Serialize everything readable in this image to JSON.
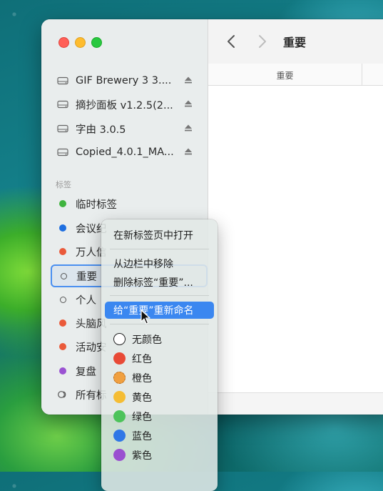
{
  "window": {
    "title": "重要"
  },
  "column": {
    "header": "重要"
  },
  "sidebar": {
    "devices": [
      {
        "label": "GIF Brewery 3 3...."
      },
      {
        "label": "摘抄面板 v1.2.5(2..."
      },
      {
        "label": "字由 3.0.5"
      },
      {
        "label": "Copied_4.0.1_MA..."
      }
    ],
    "tags_heading": "标签",
    "tags": [
      {
        "label": "临时标签",
        "color": "#3fb43f"
      },
      {
        "label": "会议纪",
        "color": "#1f6fe0"
      },
      {
        "label": "万人信",
        "color": "#ea5a3a"
      },
      {
        "label": "重要",
        "color": ""
      },
      {
        "label": "个人",
        "color": ""
      },
      {
        "label": "头脑风",
        "color": "#ea5a3a"
      },
      {
        "label": "活动安",
        "color": "#ea5a3a"
      },
      {
        "label": "复盘",
        "color": "#9a52d2"
      },
      {
        "label": "所有标",
        "color": ""
      }
    ]
  },
  "menu": {
    "open_new_tab": "在新标签页中打开",
    "remove_from_sidebar": "从边栏中移除",
    "delete_tag": "删除标签“重要”...",
    "rename_tag": "给“重要”重新命名",
    "colors": [
      {
        "label": "无颜色",
        "color": "none"
      },
      {
        "label": "红色",
        "color": "#e84a36"
      },
      {
        "label": "橙色",
        "color": "#f0a040"
      },
      {
        "label": "黄色",
        "color": "#f5bd34"
      },
      {
        "label": "绿色",
        "color": "#4cc35a"
      },
      {
        "label": "蓝色",
        "color": "#2f77e6"
      },
      {
        "label": "紫色",
        "color": "#9a4fd0"
      }
    ]
  }
}
